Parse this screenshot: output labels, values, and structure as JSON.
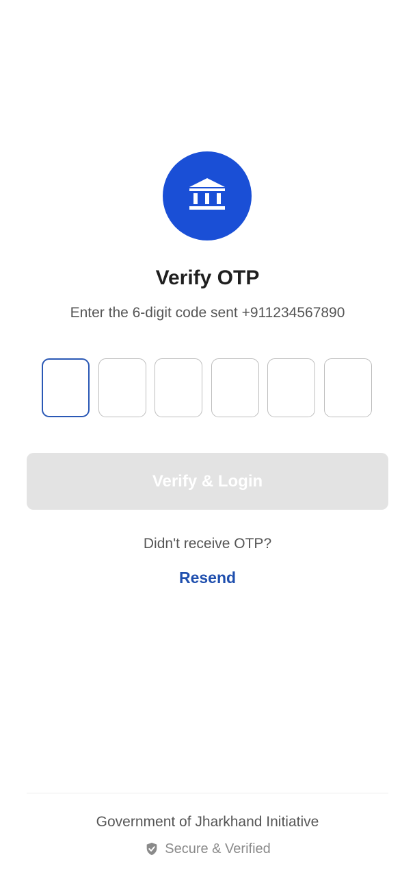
{
  "header": {
    "logo_icon": "bank-icon",
    "title": "Verify OTP",
    "subtitle": "Enter the 6-digit code sent +911234567890"
  },
  "otp": {
    "length": 6,
    "values": [
      "",
      "",
      "",
      "",
      "",
      ""
    ],
    "active_index": 0
  },
  "actions": {
    "verify_label": "Verify & Login",
    "resend_prompt": "Didn't receive OTP?",
    "resend_label": "Resend"
  },
  "footer": {
    "organization": "Government of Jharkhand Initiative",
    "secure_label": "Secure & Verified",
    "secure_icon": "shield-check-icon"
  },
  "colors": {
    "brand_blue": "#1a4fd6",
    "link_blue": "#1f4fae",
    "disabled_button": "#e3e3e3"
  }
}
